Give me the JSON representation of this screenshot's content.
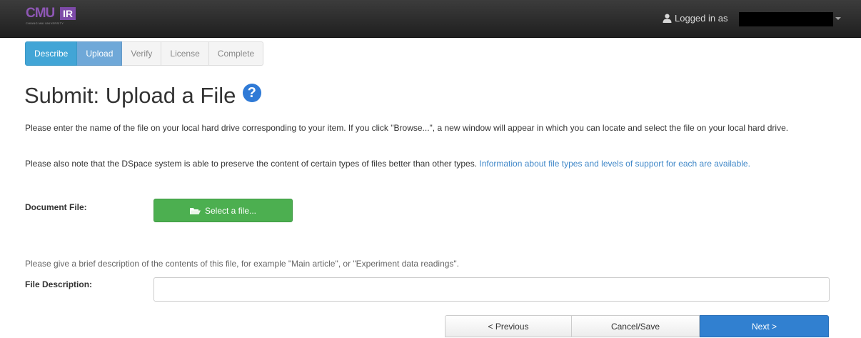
{
  "header": {
    "logo_text": "CMU",
    "logo_badge": "IR",
    "logo_subtitle": "CHIANG MAI UNIVERSITY",
    "logged_in_label": "Logged in as"
  },
  "steps": [
    {
      "label": "Describe",
      "state": "done"
    },
    {
      "label": "Upload",
      "state": "current"
    },
    {
      "label": "Verify",
      "state": "todo"
    },
    {
      "label": "License",
      "state": "todo"
    },
    {
      "label": "Complete",
      "state": "todo"
    }
  ],
  "page": {
    "title": "Submit: Upload a File",
    "help_icon": "question-circle-icon",
    "instructions": "Please enter the name of the file on your local hard drive corresponding to your item. If you click \"Browse...\", a new window will appear in which you can locate and select the file on your local hard drive.",
    "preserve_note": "Please also note that the DSpace system is able to preserve the content of certain types of files better than other types.",
    "preserve_link": "Information about file types and levels of support for each are available."
  },
  "form": {
    "document_file_label": "Document File:",
    "select_file_button": "Select a file...",
    "description_hint": "Please give a brief description of the contents of this file, for example \"Main article\", or \"Experiment data readings\".",
    "file_description_label": "File Description:",
    "file_description_value": ""
  },
  "buttons": {
    "previous": "< Previous",
    "cancel_save": "Cancel/Save",
    "next": "Next >"
  },
  "colors": {
    "navbar": "#2b2b2b",
    "step_done": "#42a5d6",
    "step_current": "#6fa8d8",
    "select_button": "#4caf50",
    "next_button": "#3180d0",
    "link": "#3f87c8",
    "help_icon": "#2f7ad6"
  }
}
